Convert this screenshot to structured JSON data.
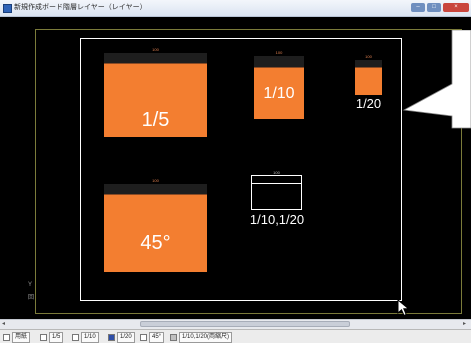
{
  "window": {
    "title": "新規作成ボード階層レイヤー（レイヤー）",
    "controls": {
      "minimize": "–",
      "maximize": "□",
      "close": "×"
    }
  },
  "ruler": {
    "left_glyphs": [
      "Y",
      "回"
    ]
  },
  "artboard": {
    "panels": [
      {
        "id": "1-5",
        "label": "1/5",
        "dimension": "100"
      },
      {
        "id": "1-10",
        "label": "1/10",
        "dimension": "100"
      },
      {
        "id": "1-20",
        "label": "1/20",
        "dimension": "100"
      },
      {
        "id": "45",
        "label": "45°",
        "dimension": "100"
      },
      {
        "id": "outline",
        "label": "1/10,1/20",
        "dimension": "100"
      }
    ]
  },
  "scrollbar": {
    "left_arrow": "◂",
    "right_arrow": "▸"
  },
  "layer_tabs": [
    {
      "label": "用紙",
      "color": "#ffffff"
    },
    {
      "label": "1/5",
      "color": "#ffffff"
    },
    {
      "label": "1/10",
      "color": "#ffffff"
    },
    {
      "label": "1/20",
      "color": "#2f4fa8"
    },
    {
      "label": "45°",
      "color": "#ffffff"
    },
    {
      "label": "1/10,1/20(両縮尺)",
      "color": "#c0c0c0"
    }
  ],
  "colors": {
    "panel_fill": "#f37e30",
    "canvas_bg": "#000000",
    "artboard_border": "#ffffff"
  }
}
